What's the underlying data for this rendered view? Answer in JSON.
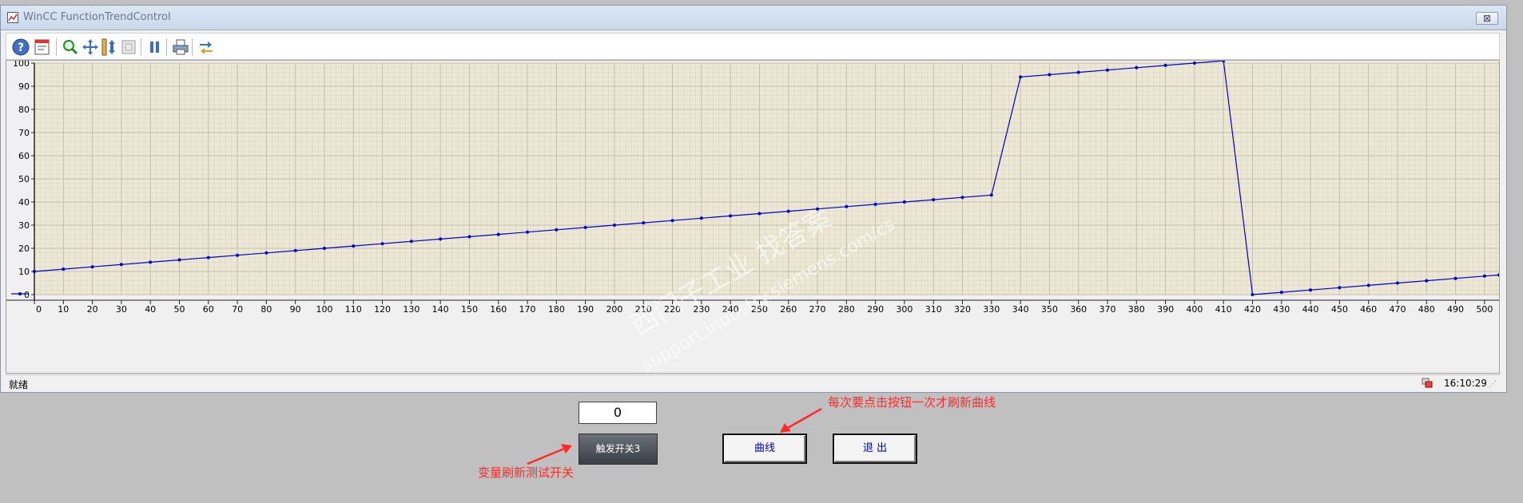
{
  "window": {
    "title": "WinCC FunctionTrendControl",
    "close_label": "⊠"
  },
  "toolbar": {
    "buttons": [
      {
        "name": "help-icon"
      },
      {
        "name": "config-dialog-icon"
      },
      {
        "name": "zoom-area-icon"
      },
      {
        "name": "move-curves-icon"
      },
      {
        "name": "zoom-y-axis-icon"
      },
      {
        "name": "original-view-icon"
      },
      {
        "name": "pause-icon"
      },
      {
        "name": "print-icon"
      },
      {
        "name": "export-data-icon"
      }
    ]
  },
  "chart_data": {
    "type": "line",
    "x": [
      0,
      10,
      20,
      30,
      40,
      50,
      60,
      70,
      80,
      90,
      100,
      110,
      120,
      130,
      140,
      150,
      160,
      170,
      180,
      190,
      200,
      210,
      220,
      230,
      240,
      250,
      260,
      270,
      280,
      290,
      300,
      310,
      320,
      330,
      340,
      350,
      360,
      370,
      380,
      390,
      400,
      410,
      420,
      430,
      440,
      450,
      460,
      470,
      480,
      490,
      500,
      505
    ],
    "series": [
      {
        "color": "#0000cc",
        "values": [
          10,
          11,
          12,
          13,
          14,
          15,
          16,
          17,
          18,
          19,
          20,
          21,
          22,
          23,
          24,
          25,
          26,
          27,
          28,
          29,
          30,
          31,
          32,
          33,
          34,
          35,
          36,
          37,
          38,
          39,
          40,
          41,
          42,
          43,
          94,
          95,
          96,
          97,
          98,
          99,
          100,
          101,
          0,
          1,
          2,
          3,
          4,
          5,
          6,
          7,
          8,
          8.5
        ]
      }
    ],
    "xlim": [
      0,
      505
    ],
    "ylim": [
      0,
      100
    ],
    "x_ticks": [
      0,
      10,
      20,
      30,
      40,
      50,
      60,
      70,
      80,
      90,
      100,
      110,
      120,
      130,
      140,
      150,
      160,
      170,
      180,
      190,
      200,
      210,
      220,
      230,
      240,
      250,
      260,
      270,
      280,
      290,
      300,
      310,
      320,
      330,
      340,
      350,
      360,
      370,
      380,
      390,
      400,
      410,
      420,
      430,
      440,
      450,
      460,
      470,
      480,
      490,
      500
    ],
    "y_ticks": [
      0,
      10,
      20,
      30,
      40,
      50,
      60,
      70,
      80,
      90,
      100
    ],
    "grid": true,
    "background": "#ece8d5",
    "gridline_color": "#c4c0aa"
  },
  "watermark": {
    "line1": "西门子工业   找答案",
    "line2": "support.industry.siemens.com/cs"
  },
  "status": {
    "text": "就绪",
    "time": "16:10:29"
  },
  "controls": {
    "value": "0",
    "trigger_label": "触发开关3",
    "curve_label": "曲线",
    "exit_label": "退 出"
  },
  "annotations": {
    "top": "每次要点击按钮一次才刷新曲线",
    "bottom": "变量刷新测试开关",
    "color": "#ff2a2a"
  }
}
